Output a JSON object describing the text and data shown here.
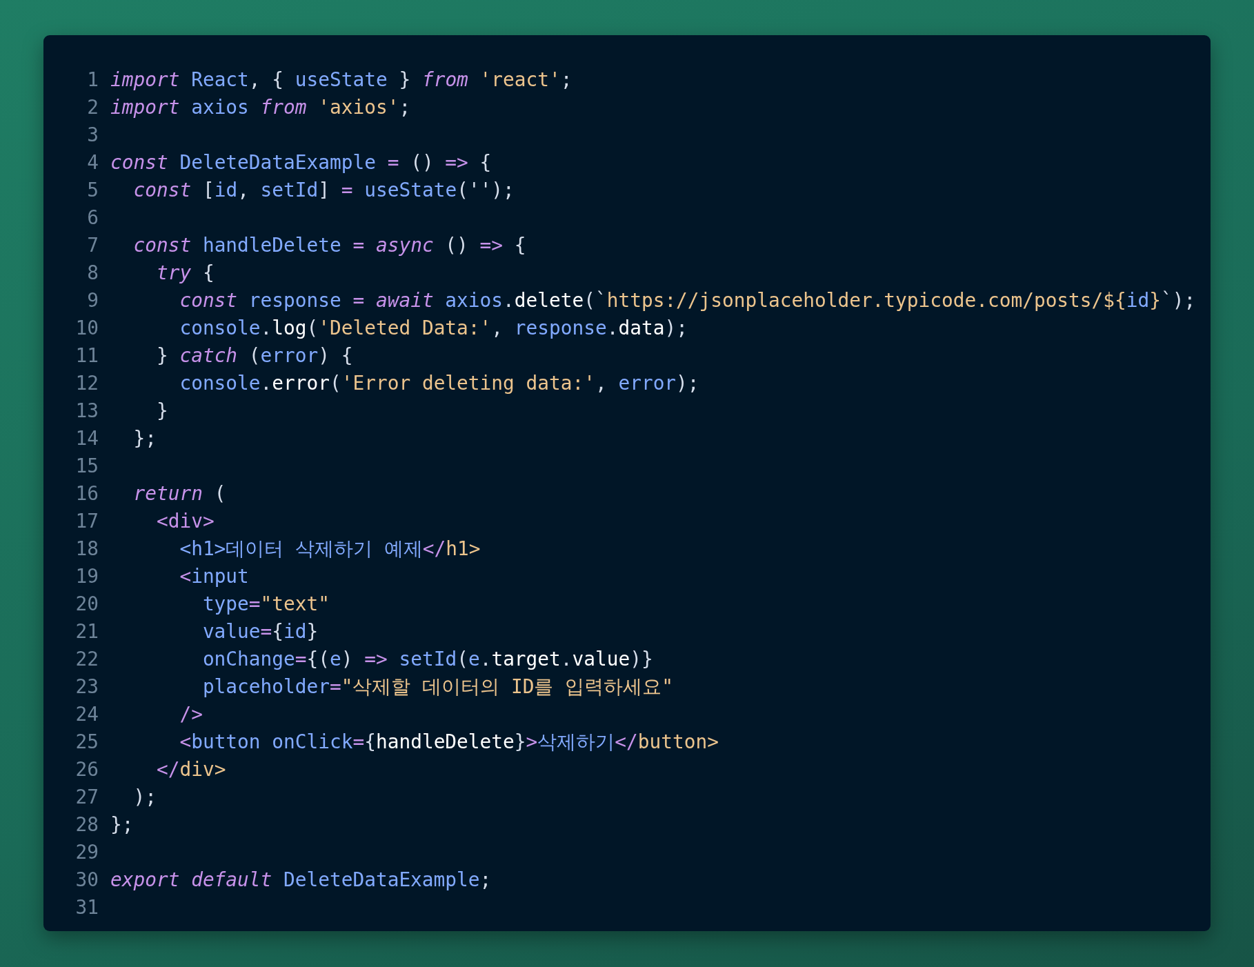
{
  "code_lines": [
    {
      "number": "1",
      "tokens": [
        {
          "kind": "kw",
          "text": "import "
        },
        {
          "kind": "id",
          "text": "React"
        },
        {
          "kind": "p",
          "text": ", { "
        },
        {
          "kind": "id",
          "text": "useState"
        },
        {
          "kind": "p",
          "text": " } "
        },
        {
          "kind": "kw",
          "text": "from "
        },
        {
          "kind": "str",
          "text": "'react'"
        },
        {
          "kind": "p",
          "text": ";"
        }
      ]
    },
    {
      "number": "2",
      "tokens": [
        {
          "kind": "kw",
          "text": "import "
        },
        {
          "kind": "id",
          "text": "axios "
        },
        {
          "kind": "kw",
          "text": "from "
        },
        {
          "kind": "str",
          "text": "'axios'"
        },
        {
          "kind": "p",
          "text": ";"
        }
      ]
    },
    {
      "number": "3"
    },
    {
      "number": "4",
      "tokens": [
        {
          "kind": "kw",
          "text": "const "
        },
        {
          "kind": "id",
          "text": "DeleteDataExample "
        },
        {
          "kind": "op",
          "text": "= "
        },
        {
          "kind": "p",
          "text": "() "
        },
        {
          "kind": "op",
          "text": "=> "
        },
        {
          "kind": "p",
          "text": "{"
        }
      ]
    },
    {
      "number": "5",
      "tokens": [
        {
          "kind": "kw",
          "text": "  const "
        },
        {
          "kind": "p",
          "text": "["
        },
        {
          "kind": "id",
          "text": "id"
        },
        {
          "kind": "p",
          "text": ", "
        },
        {
          "kind": "id",
          "text": "setId"
        },
        {
          "kind": "p",
          "text": "] "
        },
        {
          "kind": "op",
          "text": "= "
        },
        {
          "kind": "id",
          "text": "useState"
        },
        {
          "kind": "p",
          "text": "('');"
        }
      ]
    },
    {
      "number": "6"
    },
    {
      "number": "7",
      "tokens": [
        {
          "kind": "kw",
          "text": "  const "
        },
        {
          "kind": "id",
          "text": "handleDelete "
        },
        {
          "kind": "op",
          "text": "= "
        },
        {
          "kind": "kw",
          "text": "async "
        },
        {
          "kind": "p",
          "text": "() "
        },
        {
          "kind": "op",
          "text": "=> "
        },
        {
          "kind": "p",
          "text": "{"
        }
      ]
    },
    {
      "number": "8",
      "tokens": [
        {
          "kind": "kw",
          "text": "    try "
        },
        {
          "kind": "p",
          "text": "{"
        }
      ]
    },
    {
      "number": "9",
      "tokens": [
        {
          "kind": "kw",
          "text": "      const "
        },
        {
          "kind": "id",
          "text": "response "
        },
        {
          "kind": "op",
          "text": "= "
        },
        {
          "kind": "kw",
          "text": "await "
        },
        {
          "kind": "id",
          "text": "axios"
        },
        {
          "kind": "p",
          "text": "."
        },
        {
          "kind": "w",
          "text": "delete"
        },
        {
          "kind": "p",
          "text": "(`"
        },
        {
          "kind": "str",
          "text": "https://jsonplaceholder.typicode.com/posts/${"
        },
        {
          "kind": "id",
          "text": "id"
        },
        {
          "kind": "str",
          "text": "}"
        },
        {
          "kind": "p",
          "text": "`);"
        }
      ]
    },
    {
      "number": "10",
      "tokens": [
        {
          "kind": "id",
          "text": "      console"
        },
        {
          "kind": "p",
          "text": "."
        },
        {
          "kind": "w",
          "text": "log"
        },
        {
          "kind": "p",
          "text": "("
        },
        {
          "kind": "str",
          "text": "'Deleted Data:'"
        },
        {
          "kind": "p",
          "text": ", "
        },
        {
          "kind": "id",
          "text": "response"
        },
        {
          "kind": "p",
          "text": "."
        },
        {
          "kind": "w",
          "text": "data"
        },
        {
          "kind": "p",
          "text": ");"
        }
      ]
    },
    {
      "number": "11",
      "tokens": [
        {
          "kind": "p",
          "text": "    } "
        },
        {
          "kind": "kw",
          "text": "catch "
        },
        {
          "kind": "p",
          "text": "("
        },
        {
          "kind": "id",
          "text": "error"
        },
        {
          "kind": "p",
          "text": ") {"
        }
      ]
    },
    {
      "number": "12",
      "tokens": [
        {
          "kind": "id",
          "text": "      console"
        },
        {
          "kind": "p",
          "text": "."
        },
        {
          "kind": "w",
          "text": "error"
        },
        {
          "kind": "p",
          "text": "("
        },
        {
          "kind": "str",
          "text": "'Error deleting data:'"
        },
        {
          "kind": "p",
          "text": ", "
        },
        {
          "kind": "id",
          "text": "error"
        },
        {
          "kind": "p",
          "text": ");"
        }
      ]
    },
    {
      "number": "13",
      "tokens": [
        {
          "kind": "p",
          "text": "    }"
        }
      ]
    },
    {
      "number": "14",
      "tokens": [
        {
          "kind": "p",
          "text": "  };"
        }
      ]
    },
    {
      "number": "15"
    },
    {
      "number": "16",
      "tokens": [
        {
          "kind": "kw",
          "text": "  return "
        },
        {
          "kind": "p",
          "text": "("
        }
      ]
    },
    {
      "number": "17",
      "tokens": [
        {
          "kind": "op",
          "text": "    <div>"
        }
      ]
    },
    {
      "number": "18",
      "tokens": [
        {
          "kind": "id",
          "text": "      <h1>데이터 삭제하기 예제"
        },
        {
          "kind": "op",
          "text": "</"
        },
        {
          "kind": "str",
          "text": "h1>"
        }
      ]
    },
    {
      "number": "19",
      "tokens": [
        {
          "kind": "op",
          "text": "      <"
        },
        {
          "kind": "id",
          "text": "input"
        }
      ]
    },
    {
      "number": "20",
      "tokens": [
        {
          "kind": "id",
          "text": "        type"
        },
        {
          "kind": "op",
          "text": "="
        },
        {
          "kind": "str",
          "text": "\"text\""
        }
      ]
    },
    {
      "number": "21",
      "tokens": [
        {
          "kind": "id",
          "text": "        value"
        },
        {
          "kind": "op",
          "text": "="
        },
        {
          "kind": "p",
          "text": "{"
        },
        {
          "kind": "id",
          "text": "id"
        },
        {
          "kind": "p",
          "text": "}"
        }
      ]
    },
    {
      "number": "22",
      "tokens": [
        {
          "kind": "id",
          "text": "        onChange"
        },
        {
          "kind": "op",
          "text": "="
        },
        {
          "kind": "p",
          "text": "{("
        },
        {
          "kind": "id",
          "text": "e"
        },
        {
          "kind": "p",
          "text": ") "
        },
        {
          "kind": "op",
          "text": "=> "
        },
        {
          "kind": "id",
          "text": "setId"
        },
        {
          "kind": "p",
          "text": "("
        },
        {
          "kind": "id",
          "text": "e"
        },
        {
          "kind": "p",
          "text": "."
        },
        {
          "kind": "w",
          "text": "target"
        },
        {
          "kind": "p",
          "text": "."
        },
        {
          "kind": "w",
          "text": "value"
        },
        {
          "kind": "p",
          "text": ")}"
        }
      ]
    },
    {
      "number": "23",
      "tokens": [
        {
          "kind": "id",
          "text": "        placeholder"
        },
        {
          "kind": "op",
          "text": "="
        },
        {
          "kind": "str",
          "text": "\"삭제할 데이터의 ID를 입력하세요\""
        }
      ]
    },
    {
      "number": "24",
      "tokens": [
        {
          "kind": "op",
          "text": "      />"
        }
      ]
    },
    {
      "number": "25",
      "tokens": [
        {
          "kind": "op",
          "text": "      <"
        },
        {
          "kind": "id",
          "text": "button onClick"
        },
        {
          "kind": "op",
          "text": "="
        },
        {
          "kind": "p",
          "text": "{"
        },
        {
          "kind": "w",
          "text": "handleDelete"
        },
        {
          "kind": "p",
          "text": "}"
        },
        {
          "kind": "op",
          "text": ">"
        },
        {
          "kind": "id",
          "text": "삭제하기"
        },
        {
          "kind": "op",
          "text": "</"
        },
        {
          "kind": "str",
          "text": "button>"
        }
      ]
    },
    {
      "number": "26",
      "tokens": [
        {
          "kind": "op",
          "text": "    </"
        },
        {
          "kind": "str",
          "text": "div>"
        }
      ]
    },
    {
      "number": "27",
      "tokens": [
        {
          "kind": "p",
          "text": "  );"
        }
      ]
    },
    {
      "number": "28",
      "tokens": [
        {
          "kind": "p",
          "text": "};"
        }
      ]
    },
    {
      "number": "29"
    },
    {
      "number": "30",
      "tokens": [
        {
          "kind": "kw",
          "text": "export default "
        },
        {
          "kind": "id",
          "text": "DeleteDataExample"
        },
        {
          "kind": "p",
          "text": ";"
        }
      ]
    },
    {
      "number": "31"
    }
  ]
}
